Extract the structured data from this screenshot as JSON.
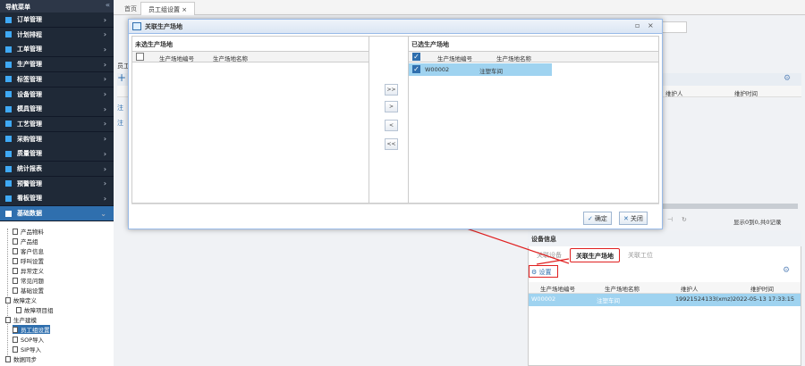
{
  "sidebar": {
    "title": "导航菜单",
    "collapse_icon": "«",
    "items": [
      {
        "label": "订单管理",
        "icon": "list-icon",
        "color": "#3fa9f5"
      },
      {
        "label": "计划排程",
        "icon": "calendar-icon",
        "color": "#3fa9f5"
      },
      {
        "label": "工单管理",
        "icon": "doc-icon",
        "color": "#3fa9f5"
      },
      {
        "label": "生产管理",
        "icon": "gear-icon",
        "color": "#3fa9f5"
      },
      {
        "label": "标签管理",
        "icon": "tag-icon",
        "color": "#3fa9f5"
      },
      {
        "label": "设备管理",
        "icon": "device-icon",
        "color": "#3fa9f5"
      },
      {
        "label": "模具管理",
        "icon": "mold-icon",
        "color": "#3fa9f5"
      },
      {
        "label": "工艺管理",
        "icon": "craft-icon",
        "color": "#3fa9f5"
      },
      {
        "label": "采购管理",
        "icon": "cart-icon",
        "color": "#3fa9f5"
      },
      {
        "label": "质量管理",
        "icon": "quality-icon",
        "color": "#3fa9f5"
      },
      {
        "label": "统计报表",
        "icon": "chart-icon",
        "color": "#3fa9f5"
      },
      {
        "label": "预警管理",
        "icon": "alert-icon",
        "color": "#3fa9f5"
      },
      {
        "label": "看板管理",
        "icon": "board-icon",
        "color": "#3fa9f5"
      },
      {
        "label": "基础数据",
        "icon": "data-icon",
        "color": "#ffffff"
      }
    ],
    "tree": [
      {
        "label": "产品物料"
      },
      {
        "label": "产品组"
      },
      {
        "label": "客户信息"
      },
      {
        "label": "呼叫设置"
      },
      {
        "label": "异常定义"
      },
      {
        "label": "常见问题"
      },
      {
        "label": "基础设置"
      },
      {
        "label": "故障定义"
      },
      {
        "label": "故障项目组"
      },
      {
        "label": "生产建模"
      },
      {
        "label": "员工组设置"
      },
      {
        "label": "SOP导入"
      },
      {
        "label": "SIP导入"
      },
      {
        "label": "数据同步"
      }
    ]
  },
  "tabs": {
    "home": "首页",
    "current": "员工组设置",
    "close": "×"
  },
  "background": {
    "left_labels": [
      "员工",
      "注",
      "注"
    ],
    "add_icon": "+",
    "col_maintainer": "维护人",
    "col_time": "维护时间",
    "pager_last": "⊣",
    "pager_refresh": "↻",
    "pager_info": "显示0到0,共0记录",
    "device_info_title": "设备信息",
    "subtabs": [
      "关联设备",
      "关联生产场地",
      "关联工位"
    ],
    "settings_btn": "设置",
    "table_headers": [
      "生产场地编号",
      "生产场地名称",
      "维护人",
      "维护时间"
    ],
    "table_rows": [
      [
        "W00002",
        "注塑车间",
        "19921524133(xmz)",
        "2022-05-13 17:33:15"
      ]
    ]
  },
  "modal": {
    "title": "关联生产场地",
    "left_title": "未选生产场地",
    "right_title": "已选生产场地",
    "col_code": "生产场地编号",
    "col_name": "生产场地名称",
    "selected_rows": [
      {
        "code": "W00002",
        "name": "注塑车间"
      }
    ],
    "move_buttons": [
      ">>",
      ">",
      "<",
      "<<"
    ],
    "ok_label": "确定",
    "close_label": "关闭",
    "ok_icon": "✓",
    "close_icon": "✕",
    "hd_restore": "▫",
    "hd_close": "×"
  }
}
